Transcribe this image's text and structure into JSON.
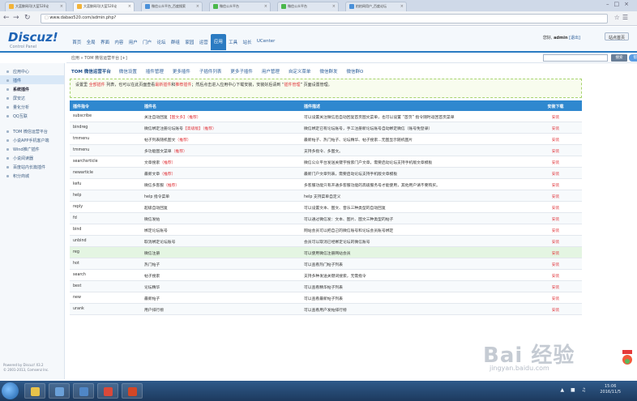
{
  "browser": {
    "tabs": [
      {
        "label": "大蓝鲸网司(大蓝520论",
        "color": "#f2b339",
        "active": false
      },
      {
        "label": "大蓝鲸网司(大蓝520论",
        "color": "#f2b339",
        "active": true
      },
      {
        "label": "微信公众平台_百度搜索",
        "color": "#4a90d9",
        "active": false
      },
      {
        "label": "微信公众平台",
        "color": "#4bb84b",
        "active": false
      },
      {
        "label": "微信公众平台",
        "color": "#4bb84b",
        "active": false
      },
      {
        "label": "拍拍网用户_百度论坛",
        "color": "#4a90d9",
        "active": false
      }
    ],
    "url": "www.dabao520.com/admin.php?"
  },
  "header": {
    "logo": "Discuz!",
    "logo_sub": "Control Panel",
    "nav": [
      "首页",
      "全局",
      "界面",
      "内容",
      "用户",
      "门户",
      "论坛",
      "群组",
      "家园",
      "运营",
      "应用",
      "工具",
      "站长",
      "UCenter"
    ],
    "active_nav": "应用",
    "user_greeting": "您好,",
    "username": "admin",
    "logout": "[退出]",
    "site_home": "站点首页"
  },
  "subbar": {
    "breadcrumb": "应用 » TOM 微信运营平台 [+]",
    "search_button": "搜索",
    "help_button": "帮助"
  },
  "sidebar": {
    "items": [
      {
        "label": "应用中心",
        "state": "normal"
      },
      {
        "label": "插件",
        "state": "active"
      },
      {
        "label": "系统插件",
        "state": "bold"
      },
      {
        "label": "屏安达",
        "state": "normal"
      },
      {
        "label": "量化分析",
        "state": "normal"
      },
      {
        "label": "QQ互联",
        "state": "normal"
      },
      {
        "label": "",
        "state": "spacer"
      },
      {
        "label": "TOM 微信运营平台",
        "state": "normal"
      },
      {
        "label": "小说APP手机客户端",
        "state": "normal"
      },
      {
        "label": "Wind推广插件",
        "state": "normal"
      },
      {
        "label": "小说阅读器",
        "state": "normal"
      },
      {
        "label": "百度站内长篇插件",
        "state": "normal"
      },
      {
        "label": "积分商城",
        "state": "normal"
      }
    ],
    "footer_line1": "Powered by Discuz! X3.2",
    "footer_line2": "© 2001-2013, Comsenz Inc."
  },
  "main": {
    "subtabs": [
      "TOM 微信运营平台",
      "微信设置",
      "插件管理",
      "更多插件",
      "子插件列表",
      "更多子插件",
      "用户管理",
      "自定义菜单",
      "微信群发",
      "微信群O"
    ],
    "notice_parts": [
      {
        "text": "设置里 ",
        "red": false
      },
      {
        "text": "全部插件",
        "red": true
      },
      {
        "text": " 列表，也可以在此页面查看",
        "red": false
      },
      {
        "text": "最新插件",
        "red": true
      },
      {
        "text": "和",
        "red": false
      },
      {
        "text": "推荐插件",
        "red": true
      },
      {
        "text": "；然后点击进入应用中心下载安装，安装好后请到 “",
        "red": false
      },
      {
        "text": "插件管理",
        "red": true
      },
      {
        "text": "” 页面设置管理。",
        "red": false
      }
    ],
    "table": {
      "headers": [
        "插件指令",
        "插件名",
        "插件描述",
        "安装下载"
      ],
      "rows": [
        {
          "cmd": "subscribe",
          "name": "关注自动回复",
          "tag1": "【图文多】",
          "tag2": "（推荐）",
          "desc": "可以设置关注微信后自动回复首页图文菜单，也可以设置 “首页” 指令随时返回首页菜单",
          "action": "安装",
          "hl": false
        },
        {
          "cmd": "bindreg",
          "name": "微信绑定注册论坛账号",
          "tag1": "【高级版】",
          "tag2": "（推荐）",
          "desc": "微信绑定已有论坛账号，手工注册新论坛账号自动绑定微信（账号免登录）",
          "action": "安装",
          "hl": false
        },
        {
          "cmd": "tmmenu",
          "name": "帖子列表随机图文",
          "tag1": "",
          "tag2": "（推荐）",
          "desc": "最新帖子、热门帖子、论坛精华、帖子搜索...无图显示随机图片",
          "action": "安装",
          "hl": false
        },
        {
          "cmd": "tmmenu",
          "name": "多功能图文菜单",
          "tag1": "",
          "tag2": "（推荐）",
          "desc": "支持多指令、多图文。",
          "action": "安装",
          "hl": false
        },
        {
          "cmd": "searchsrticle",
          "name": "文章搜索",
          "tag1": "",
          "tag2": "（推荐）",
          "desc": "微信公众平台发送关键字搜索门户文章，需要启动论坛支持手机版文章模板",
          "action": "安装",
          "hl": false
        },
        {
          "cmd": "newarticle",
          "name": "最新文章",
          "tag1": "",
          "tag2": "（推荐）",
          "desc": "最新门户文章列表，需要启动论坛支持手机版文章模板",
          "action": "安装",
          "hl": false
        },
        {
          "cmd": "kefu",
          "name": "微信多客服",
          "tag1": "",
          "tag2": "（推荐）",
          "desc": "多客服功能只有开通多客服功能的高级服务号才能使用，其他用户请不要购买。",
          "action": "安装",
          "hl": false
        },
        {
          "cmd": "help",
          "name": "help 指令菜单",
          "tag1": "",
          "tag2": "",
          "desc": "help 支持菜单自定义",
          "action": "安装",
          "hl": false
        },
        {
          "cmd": "reply",
          "name": "超级自动回复",
          "tag1": "",
          "tag2": "",
          "desc": "可以设置文本、图文、音乐三种类型的自动回复",
          "action": "安装",
          "hl": false
        },
        {
          "cmd": "fd",
          "name": "微信发帖",
          "tag1": "",
          "tag2": "",
          "desc": "可以通过微信发：文本、图片、图文三种类型的帖子",
          "action": "安装",
          "hl": false
        },
        {
          "cmd": "bind",
          "name": "绑定论坛账号",
          "tag1": "",
          "tag2": "",
          "desc": "网站会员可以把自己的微信账号和论坛会员账号绑定",
          "action": "安装",
          "hl": false
        },
        {
          "cmd": "unbind",
          "name": "取消绑定论坛账号",
          "tag1": "",
          "tag2": "",
          "desc": "会员可以取消已经绑定论坛的微信账号",
          "action": "安装",
          "hl": false
        },
        {
          "cmd": "reg",
          "name": "微信注册",
          "tag1": "",
          "tag2": "",
          "desc": "可以使用微信注册网站会员",
          "action": "安装",
          "hl": true
        },
        {
          "cmd": "hot",
          "name": "热门帖子",
          "tag1": "",
          "tag2": "",
          "desc": "可以查看热门帖子列表",
          "action": "安装",
          "hl": false
        },
        {
          "cmd": "search",
          "name": "帖子搜索",
          "tag1": "",
          "tag2": "",
          "desc": "支持多种发送关键词搜索，无需指令",
          "action": "安装",
          "hl": false
        },
        {
          "cmd": "best",
          "name": "论坛精华",
          "tag1": "",
          "tag2": "",
          "desc": "可以查看精华帖子列表",
          "action": "安装",
          "hl": false
        },
        {
          "cmd": "new",
          "name": "最新帖子",
          "tag1": "",
          "tag2": "",
          "desc": "可以查看最新帖子列表",
          "action": "安装",
          "hl": false
        },
        {
          "cmd": "urank",
          "name": "用户排行榜",
          "tag1": "",
          "tag2": "",
          "desc": "可以查看用户发帖排行榜",
          "action": "安装",
          "hl": false
        }
      ]
    }
  },
  "watermark": {
    "text": "Bai 经验",
    "url": "jingyan.baidu.com"
  },
  "taskbar": {
    "apps": [
      {
        "name": "explorer",
        "color": "#e8c24a"
      },
      {
        "name": "media",
        "color": "#6aa0d8"
      },
      {
        "name": "gallery",
        "color": "#4f86c6"
      },
      {
        "name": "chrome",
        "color": "#d9493a"
      },
      {
        "name": "powerpoint",
        "color": "#d24726"
      }
    ],
    "time": "15:06",
    "date": "2016/11/5"
  },
  "colors": {
    "accent": "#2b7bc2",
    "install": "#e0353b",
    "highlight_row": "#e4f5e2"
  }
}
